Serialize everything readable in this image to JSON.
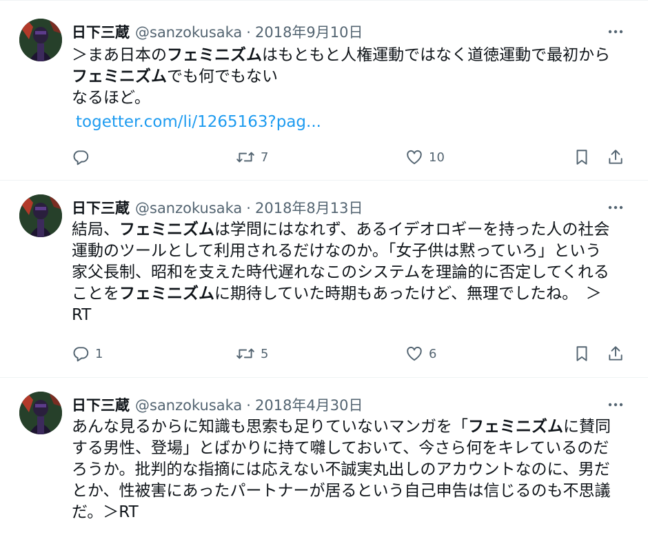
{
  "tweets": [
    {
      "name": "日下三蔵",
      "handle": "@sanzokusaka",
      "separator": "·",
      "date": "2018年9月10日",
      "body_lines": [
        [
          {
            "text": "＞まあ日本の",
            "bold": false
          },
          {
            "text": "フェミニズム",
            "bold": true
          },
          {
            "text": "はもともと人権運動ではなく道徳運動で最初から",
            "bold": false
          }
        ],
        [
          {
            "text": "フェミニズム",
            "bold": true
          },
          {
            "text": "でも何でもない",
            "bold": false
          }
        ],
        [
          {
            "text": "なるほど。",
            "bold": false
          }
        ]
      ],
      "link": "togetter.com/li/1265163?pag...",
      "replies": "",
      "retweets": "7",
      "likes": "10"
    },
    {
      "name": "日下三蔵",
      "handle": "@sanzokusaka",
      "separator": "·",
      "date": "2018年8月13日",
      "body_lines": [
        [
          {
            "text": "結局、",
            "bold": false
          },
          {
            "text": "フェミニズム",
            "bold": true
          },
          {
            "text": "は学問にはなれず、あるイデオロギーを持った人の社会",
            "bold": false
          }
        ],
        [
          {
            "text": "運動のツールとして利用されるだけなのか。「女子供は黙っていろ」という",
            "bold": false
          }
        ],
        [
          {
            "text": "家父長制、昭和を支えた時代遅れなこのシステムを理論的に否定してくれる",
            "bold": false
          }
        ],
        [
          {
            "text": "ことを",
            "bold": false
          },
          {
            "text": "フェミニズム",
            "bold": true
          },
          {
            "text": "に期待していた時期もあったけど、無理でしたね。　＞",
            "bold": false
          }
        ],
        [
          {
            "text": "RT",
            "bold": false
          }
        ]
      ],
      "link": "",
      "replies": "1",
      "retweets": "5",
      "likes": "6"
    },
    {
      "name": "日下三蔵",
      "handle": "@sanzokusaka",
      "separator": "·",
      "date": "2018年4月30日",
      "body_lines": [
        [
          {
            "text": "あんな見るからに知識も思索も足りていないマンガを「",
            "bold": false
          },
          {
            "text": "フェミニズム",
            "bold": true
          },
          {
            "text": "に賛同",
            "bold": false
          }
        ],
        [
          {
            "text": "する男性、登場」とばかりに持て囃しておいて、今さら何をキレているのだ",
            "bold": false
          }
        ],
        [
          {
            "text": "ろうか。批判的な指摘には応えない不誠実丸出しのアカウントなのに、男だ",
            "bold": false
          }
        ],
        [
          {
            "text": "とか、性被害にあったパートナーが居るという自己申告は信じるのも不思議",
            "bold": false
          }
        ],
        [
          {
            "text": "だ。＞RT",
            "bold": false
          }
        ]
      ],
      "link": "",
      "replies": "",
      "retweets": "",
      "likes": ""
    }
  ],
  "icons": {
    "more": "more-horizontal-icon",
    "reply": "reply-bubble-icon",
    "retweet": "retweet-arrows-icon",
    "like": "heart-outline-icon",
    "bookmark": "bookmark-icon",
    "share": "share-upload-icon"
  },
  "colors": {
    "text": "#0f1419",
    "secondary": "#536471",
    "link": "#1d9bf0",
    "divider": "#eff3f4",
    "background": "#ffffff"
  }
}
